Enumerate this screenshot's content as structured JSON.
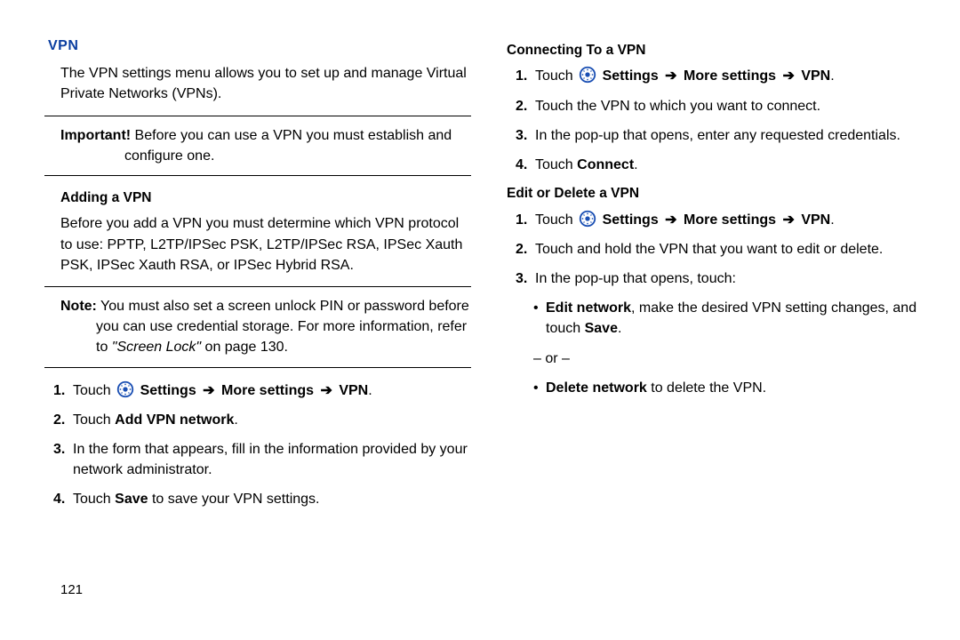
{
  "title": "VPN",
  "intro": "The VPN settings menu allows you to set up and manage Virtual Private Networks (VPNs).",
  "important_label": "Important!",
  "important_text": " Before you can use a VPN you must establish and configure one.",
  "adding": {
    "title": "Adding a VPN",
    "intro": "Before you add a VPN you must determine which VPN protocol to use: PPTP, L2TP/IPSec PSK, L2TP/IPSec RSA, IPSec Xauth PSK, IPSec Xauth RSA, or IPSec Hybrid RSA.",
    "note_label": "Note:",
    "note_text": " You must also set a screen unlock PIN or password before you can use credential storage. For more information, refer to ",
    "note_ref": "\"Screen Lock\"",
    "note_tail": " on page 130.",
    "steps": {
      "s1_pre": "Touch ",
      "s1_path1": " Settings ",
      "s1_path2": " More settings ",
      "s1_path3": " VPN",
      "s1_dot": ".",
      "s2_pre": "Touch ",
      "s2_b": "Add VPN network",
      "s2_dot": ".",
      "s3": "In the form that appears, fill in the information provided by your network administrator.",
      "s4_pre": "Touch ",
      "s4_b": "Save",
      "s4_post": " to save your VPN settings."
    }
  },
  "connecting": {
    "title": "Connecting To a VPN",
    "steps": {
      "s1_pre": "Touch ",
      "s1_path1": " Settings ",
      "s1_path2": " More settings ",
      "s1_path3": " VPN",
      "s1_dot": ".",
      "s2": "Touch the VPN to which you want to connect.",
      "s3": "In the pop-up that opens, enter any requested credentials.",
      "s4_pre": "Touch ",
      "s4_b": "Connect",
      "s4_dot": "."
    }
  },
  "edit": {
    "title": "Edit or Delete a VPN",
    "steps": {
      "s1_pre": "Touch ",
      "s1_path1": " Settings ",
      "s1_path2": " More settings ",
      "s1_path3": " VPN",
      "s1_dot": ".",
      "s2": "Touch and hold the VPN that you want to edit or delete.",
      "s3": "In the pop-up that opens, touch:"
    },
    "bullet1_b": "Edit network",
    "bullet1_text": ", make the desired VPN setting changes, and touch ",
    "bullet1_b2": "Save",
    "bullet1_dot": ".",
    "or": "– or –",
    "bullet2_b": "Delete network",
    "bullet2_text": " to delete the VPN."
  },
  "page_num": "121",
  "nums": {
    "n1": "1.",
    "n2": "2.",
    "n3": "3.",
    "n4": "4."
  },
  "arrow": "➔",
  "bullet": "•"
}
